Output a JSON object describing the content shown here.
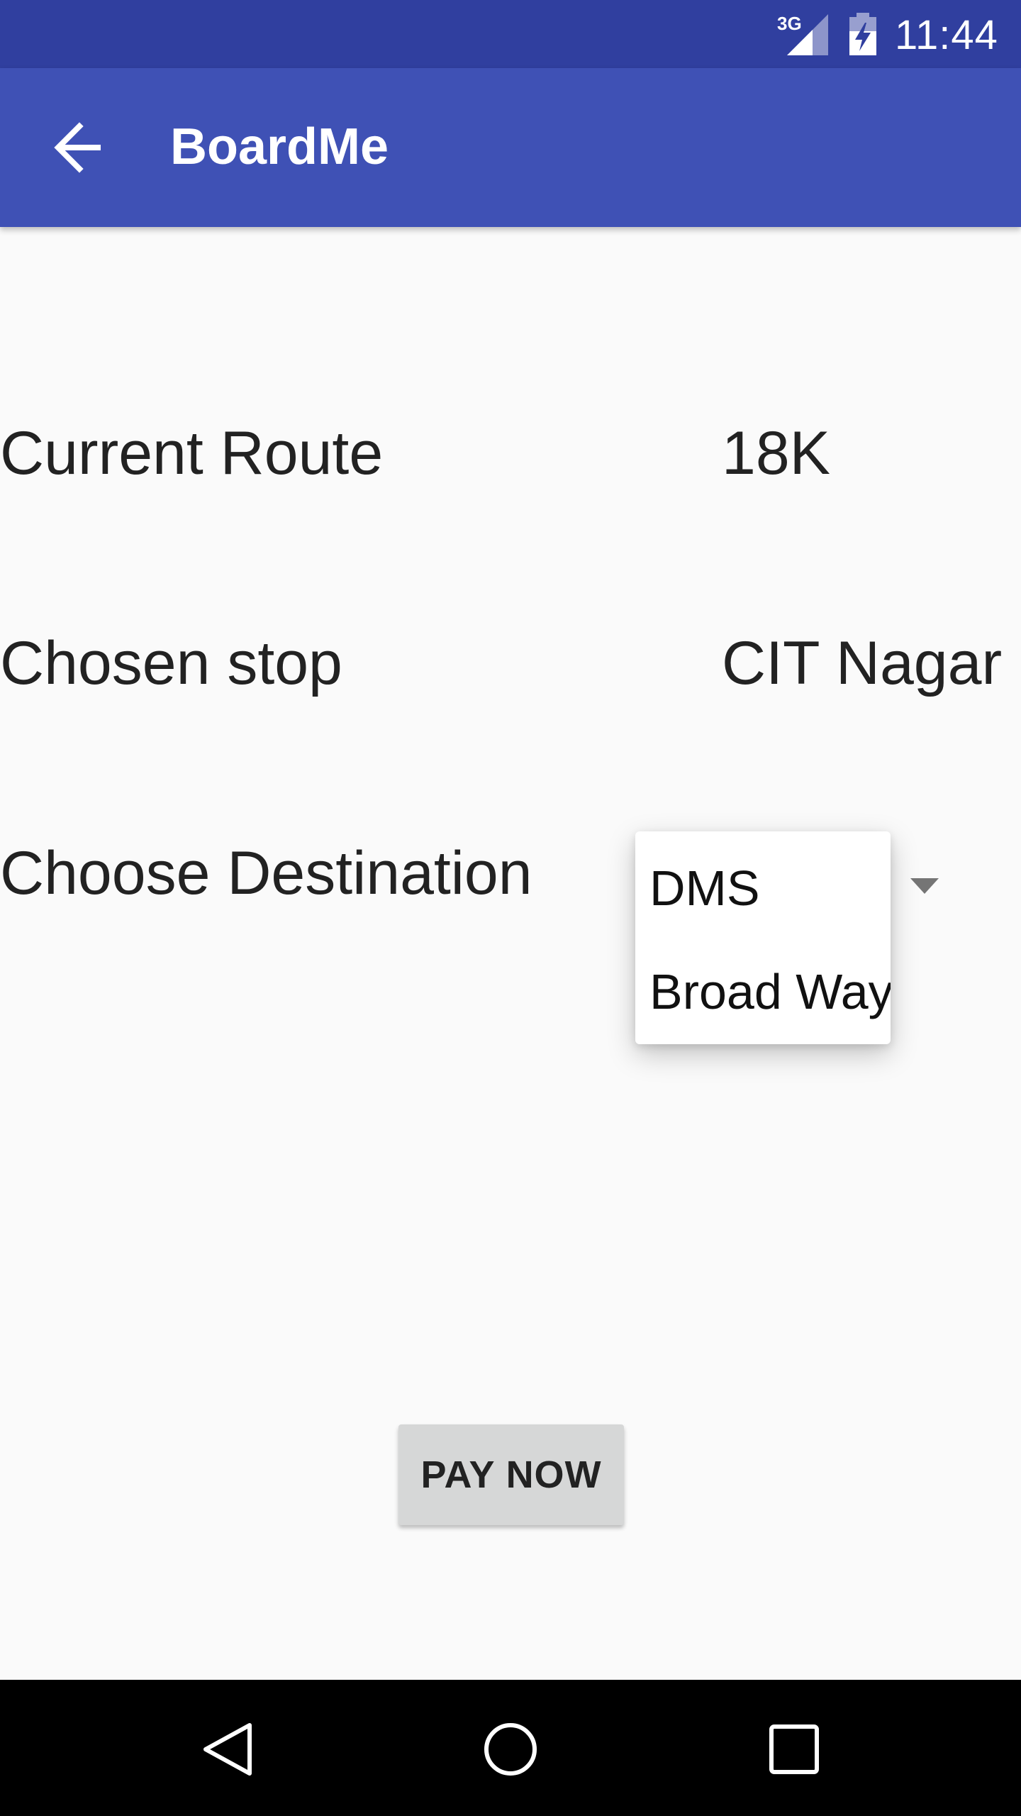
{
  "status_bar": {
    "network": "3G",
    "time": "11:44"
  },
  "app_bar": {
    "title": "BoardMe",
    "back_icon": "arrow-back-icon"
  },
  "form": {
    "route_label": "Current Route",
    "route_value": "18K",
    "stop_label": "Chosen stop",
    "stop_value": "CIT Nagar",
    "destination_label": "Choose Destination",
    "destination_options": [
      "DMS",
      "Broad Way"
    ]
  },
  "actions": {
    "pay_label": "PAY NOW"
  },
  "nav_bar": {
    "icons": [
      "nav-back-icon",
      "nav-home-icon",
      "nav-recents-icon"
    ]
  },
  "colors": {
    "status_bar": "#303f9f",
    "app_bar": "#3f51b5",
    "background": "#fafafa",
    "button": "#d6d7d7"
  }
}
